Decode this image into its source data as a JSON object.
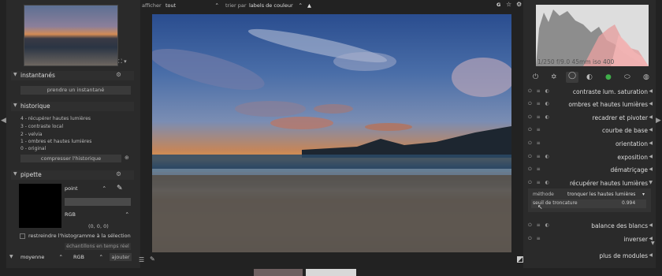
{
  "topbar": {
    "show_label": "afficher",
    "show_value": "tout",
    "sort_label": "trier par",
    "sort_value": "labels de couleur",
    "icon_g": "G"
  },
  "left": {
    "snapshots": {
      "title": "instantanés",
      "button": "prendre un instantané"
    },
    "history": {
      "title": "historique",
      "items": [
        "4 - récupérer hautes lumières",
        "3 - contraste local",
        "2 - velvia",
        "1 - ombres et hautes lumières",
        "0 - original"
      ],
      "compress": "compresser l'historique"
    },
    "picker": {
      "title": "pipette",
      "mode": "point",
      "color_space": "RGB",
      "value": "(0, 0, 0)",
      "restrict": "restreindre l'histogramme à la sélection",
      "live": "échantillons en temps réel",
      "stat": "moyenne",
      "stat_space": "RGB",
      "add": "ajouter"
    }
  },
  "right": {
    "histogram_info": "1/250 f/9.0 45mm iso 400",
    "modules": [
      "contraste lum. saturation",
      "ombres et hautes lumières",
      "recadrer et pivoter",
      "courbe de base",
      "orientation",
      "exposition",
      "dématriçage",
      "récupérer hautes lumières"
    ],
    "expanded": {
      "method_label": "méthode",
      "method_value": "tronquer les hautes lumières",
      "threshold_label": "seuil de troncature",
      "threshold_value": "0.994"
    },
    "modules_after": [
      "balance des blancs",
      "inverser"
    ],
    "more": "plus de modules"
  },
  "colors": {
    "bg": "#222222",
    "panel": "#2a2a2a",
    "accent_green": "#3fae4a"
  }
}
